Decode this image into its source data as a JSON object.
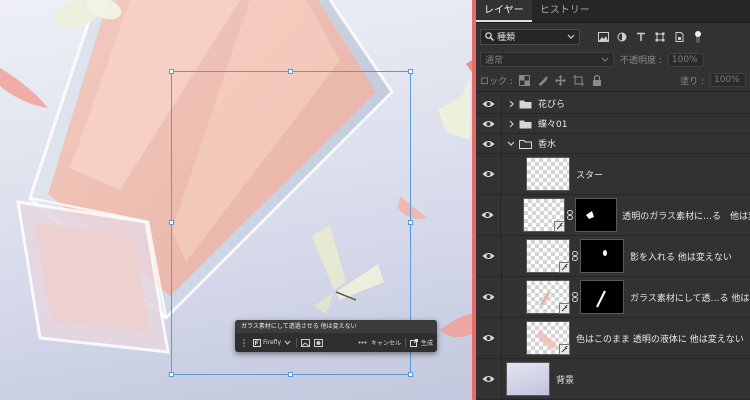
{
  "panel": {
    "tabs": [
      {
        "label": "レイヤー",
        "active": true
      },
      {
        "label": "ヒストリー",
        "active": false
      }
    ],
    "filter": {
      "kind_label": "種類",
      "icons": [
        "image-filter-icon",
        "adjustment-filter-icon",
        "type-filter-icon",
        "shape-filter-icon",
        "smart-object-filter-icon",
        "filter-toggle-icon"
      ]
    },
    "blend_mode": "通常",
    "opacity_label": "不透明度 :",
    "opacity_value": "100%",
    "lock_label": "ロック :",
    "fill_label": "塗り :",
    "fill_value": "100%"
  },
  "layers": [
    {
      "type": "group",
      "name": "花びら",
      "expanded": false
    },
    {
      "type": "group",
      "name": "蝶々01",
      "expanded": false
    },
    {
      "type": "group",
      "name": "香水",
      "expanded": true
    },
    {
      "type": "layer",
      "name": "スター",
      "nested": true,
      "mask": false
    },
    {
      "type": "layer",
      "name": "透明のガラス素材に…る　他は変",
      "nested": true,
      "mask": true
    },
    {
      "type": "layer",
      "name": "影を入れる 他は変えない",
      "nested": true,
      "mask": true
    },
    {
      "type": "layer",
      "name": "ガラス素材にして透…る 他は",
      "nested": true,
      "mask": true
    },
    {
      "type": "layer",
      "name": "色はこのまま 透明の液体に 他は変えない",
      "nested": true,
      "mask": false
    },
    {
      "type": "background",
      "name": "背景",
      "nested": false,
      "mask": false
    }
  ],
  "contextual_task_bar": {
    "prompt": "ガラス素材にして透過させる 他は変えない",
    "model_label": "Firefly",
    "cancel_label": "キャンセル",
    "generate_label": "生成"
  },
  "colors": {
    "accent_divider": "#e86a6a",
    "selection": "#5b9bd5",
    "panel_bg": "#323232"
  }
}
